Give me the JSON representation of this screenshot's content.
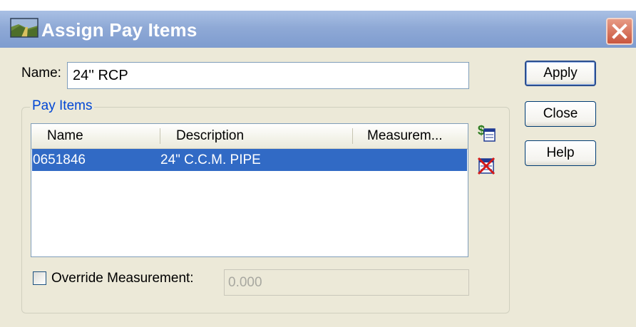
{
  "window": {
    "title": "Assign Pay Items",
    "icon": "map-icon",
    "close_icon": "close-icon"
  },
  "name_field": {
    "label": "Name:",
    "value": "24'' RCP"
  },
  "buttons": {
    "apply": "Apply",
    "close": "Close",
    "help": "Help"
  },
  "pay_items": {
    "group_title": "Pay Items",
    "columns": [
      "Name",
      "Description",
      "Measurem..."
    ],
    "rows": [
      {
        "name": "0651846",
        "description": "24\" C.C.M. PIPE",
        "measurement": "",
        "selected": true
      }
    ],
    "add_icon": "add-pay-item-icon",
    "delete_icon": "delete-pay-item-icon"
  },
  "override": {
    "label": "Override Measurement:",
    "checked": false,
    "value": "0.000"
  },
  "colors": {
    "titlebar": "#8fa9d6",
    "selection": "#316ac5",
    "dialog_bg": "#ece9d8",
    "group_title": "#0046d5"
  }
}
